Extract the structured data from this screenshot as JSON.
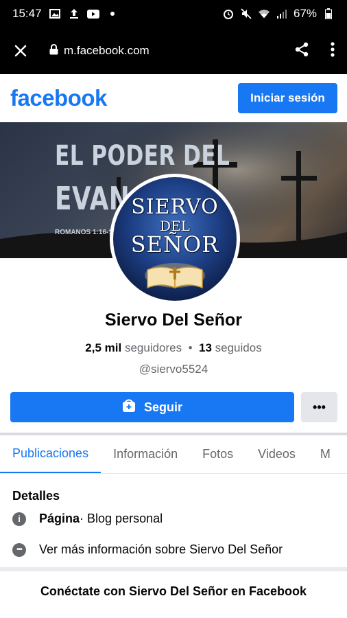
{
  "status_bar": {
    "time": "15:47",
    "battery": "67%"
  },
  "browser": {
    "url": "m.facebook.com"
  },
  "header": {
    "logo_text": "facebook",
    "login_label": "Iniciar sesión"
  },
  "cover": {
    "line1": "EL PODER DEL",
    "line2": "EVANGELIO",
    "reference": "ROMANOS 1:16-17"
  },
  "avatar": {
    "line1": "SIERVO",
    "line2": "DEL",
    "line3": "SEÑOR"
  },
  "profile": {
    "name": "Siervo Del Señor",
    "followers_count": "2,5 mil",
    "followers_label": "seguidores",
    "dot": "•",
    "following_count": "13",
    "following_label": "seguidos",
    "handle": "@siervo5524"
  },
  "actions": {
    "follow_label": "Seguir",
    "more_label": "•••"
  },
  "tabs": [
    {
      "label": "Publicaciones"
    },
    {
      "label": "Información"
    },
    {
      "label": "Fotos"
    },
    {
      "label": "Videos"
    },
    {
      "label": "M"
    }
  ],
  "details": {
    "title": "Detalles",
    "page_label": "Página",
    "page_category": " · Blog personal",
    "more_info": "Ver más información sobre Siervo Del Señor"
  },
  "footer": {
    "connect_text": "Conéctate con Siervo Del Señor en Facebook"
  },
  "colors": {
    "brand": "#1877f2",
    "secondary_text": "#65676b"
  }
}
